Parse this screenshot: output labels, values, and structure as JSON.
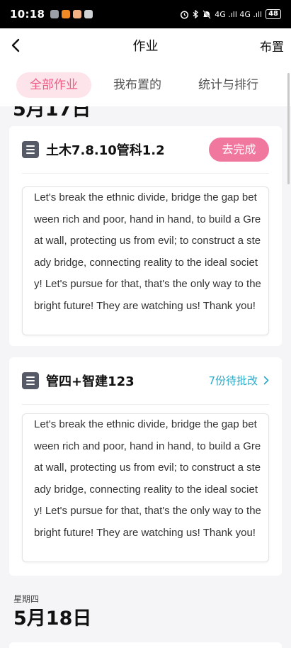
{
  "status_bar": {
    "time": "10:18",
    "signal_text": "4G .ıll 4G .ıll",
    "battery": "48",
    "app_icons": [
      "gallery-app-icon",
      "video-app-icon",
      "photo-app-icon",
      "message-app-icon"
    ],
    "app_icon_colors": [
      "#9aa0a6",
      "#f08a24",
      "#f4b183",
      "#cfd3d6"
    ]
  },
  "header": {
    "title": "作业",
    "action_label": "布置"
  },
  "tabs": [
    {
      "label": "全部作业",
      "active": true
    },
    {
      "label": "我布置的",
      "active": false
    },
    {
      "label": "统计与排行",
      "active": false
    }
  ],
  "partial_date": "5月17日",
  "assignments": [
    {
      "title": "土木7.8.10管科1.2",
      "action_label": "去完成",
      "content": "Let's break the ethnic divide, bridge the gap between rich and poor, hand in hand, to build a Great wall, protecting us from evil; to construct a steady bridge, connecting reality to the ideal society! Let's pursue for that, that's the only way to the bright future! They are watching us! Thank you!"
    },
    {
      "title": "管四+智建123",
      "pending_label": "7份待批改",
      "content": "Let's break the ethnic divide, bridge the gap between rich and poor, hand in hand, to build a Great wall, protecting us from evil; to construct a steady bridge, connecting reality to the ideal society! Let's pursue for that, that's the only way to the bright future! They are watching us! Thank you!"
    }
  ],
  "next_day": {
    "weekday": "星期四",
    "date": "5月18日"
  },
  "colors": {
    "accent_pink": "#f0789e",
    "active_tab_bg": "#fde3ea",
    "active_tab_text": "#ee5d86",
    "link_blue": "#29a9c7"
  }
}
